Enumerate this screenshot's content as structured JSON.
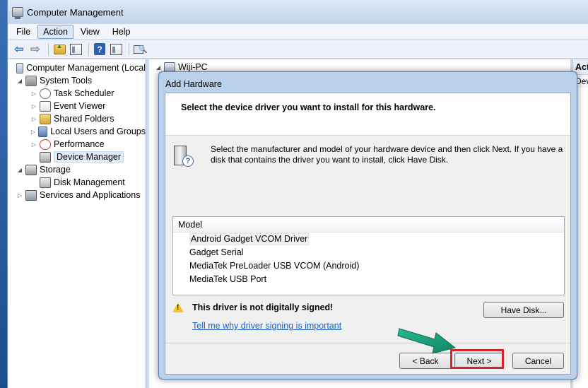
{
  "window": {
    "title": "Computer Management"
  },
  "menu": {
    "file": "File",
    "action": "Action",
    "view": "View",
    "help": "Help"
  },
  "toolbar": {
    "icons": [
      "back-arrow-icon",
      "forward-arrow-icon",
      "up-folder-icon",
      "show-hide-tree-icon",
      "help-icon",
      "properties-icon",
      "scan-hardware-icon"
    ]
  },
  "tree": {
    "root": "Computer Management (Local",
    "system_tools": "System Tools",
    "task_scheduler": "Task Scheduler",
    "event_viewer": "Event Viewer",
    "shared_folders": "Shared Folders",
    "local_users": "Local Users and Groups",
    "performance": "Performance",
    "device_manager": "Device Manager",
    "storage": "Storage",
    "disk_management": "Disk Management",
    "services": "Services and Applications"
  },
  "center": {
    "computer_name": "Wiji-PC"
  },
  "actions": {
    "header": "Act",
    "sub": "Dev"
  },
  "dialog": {
    "title": "Add Hardware",
    "heading": "Select the device driver you want to install for this hardware.",
    "intro": "Select the manufacturer and model of your hardware device and then click Next. If you have a disk that contains the driver you want to install, click Have Disk.",
    "model_header": "Model",
    "models": [
      "Android Gadget VCOM Driver",
      "Gadget Serial",
      "MediaTek PreLoader USB VCOM (Android)",
      "MediaTek USB Port"
    ],
    "selected_model": "Android Gadget VCOM Driver",
    "warning": "This driver is not digitally signed!",
    "warning_link": "Tell me why driver signing is important",
    "have_disk": "Have Disk...",
    "back": "< Back",
    "next": "Next >",
    "cancel": "Cancel"
  },
  "colors": {
    "highlight_box": "#d8232a",
    "annotation_arrow": "#1aa37a",
    "link": "#1c63c0"
  }
}
